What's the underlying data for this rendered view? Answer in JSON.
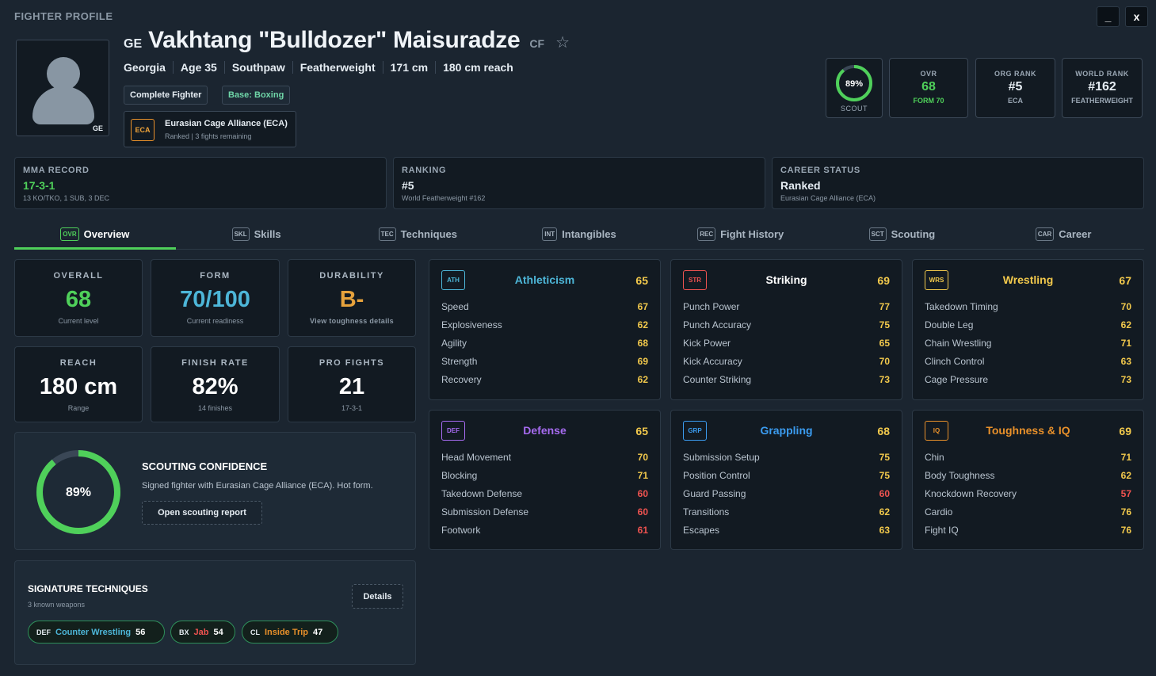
{
  "window": {
    "title": "FIGHTER PROFILE",
    "minimize": "_",
    "close": "x"
  },
  "fighter": {
    "country_code": "GE",
    "name": "Vakhtang \"Bulldozer\" Maisuradze",
    "ring_code": "CF",
    "info": [
      "Georgia",
      "Age 35",
      "Southpaw",
      "Featherweight",
      "171 cm",
      "180 cm reach"
    ],
    "tags": [
      {
        "label": "Complete Fighter",
        "color": "#e6edf3"
      },
      {
        "label": "Base: Boxing",
        "color": "#6fd6a8"
      }
    ],
    "org": {
      "logo": "ECA",
      "name": "Eurasian Cage Alliance (ECA)",
      "status": "Ranked | 3 fights remaining"
    }
  },
  "header_stats": {
    "scout": {
      "pct": "89%",
      "value": 0.89,
      "label": "SCOUT"
    },
    "ovr": {
      "label": "OVR",
      "value": "68",
      "sub": "FORM 70",
      "color": "#4fd05a"
    },
    "org_rank": {
      "label": "ORG RANK",
      "value": "#5",
      "sub": "ECA",
      "color": "#ffffff"
    },
    "world_rank": {
      "label": "WORLD RANK",
      "value": "#162",
      "sub": "FEATHERWEIGHT",
      "color": "#ffffff"
    }
  },
  "summary": {
    "record": {
      "label": "MMA RECORD",
      "value": "17-3-1",
      "sub": "13 KO/TKO, 1 SUB, 3 DEC",
      "color": "#4fd05a"
    },
    "ranking": {
      "label": "RANKING",
      "value": "#5",
      "sub": "World Featherweight #162",
      "color": "#ffffff"
    },
    "career": {
      "label": "CAREER STATUS",
      "value": "Ranked",
      "sub": "Eurasian Cage Alliance (ECA)",
      "color": "#ffffff"
    }
  },
  "tabs": [
    {
      "icon": "OVR",
      "label": "Overview",
      "active": true
    },
    {
      "icon": "SKL",
      "label": "Skills"
    },
    {
      "icon": "TEC",
      "label": "Techniques"
    },
    {
      "icon": "INT",
      "label": "Intangibles"
    },
    {
      "icon": "REC",
      "label": "Fight History"
    },
    {
      "icon": "SCT",
      "label": "Scouting"
    },
    {
      "icon": "CAR",
      "label": "Career"
    }
  ],
  "overview": [
    {
      "label": "OVERALL",
      "value": "68",
      "sub": "Current level",
      "color": "#4fd05a"
    },
    {
      "label": "FORM",
      "value": "70/100",
      "sub": "Current readiness",
      "color": "#4db6d8"
    },
    {
      "label": "DURABILITY",
      "value": "B-",
      "sub": "View toughness details",
      "color": "#e6a23c"
    },
    {
      "label": "REACH",
      "value": "180 cm",
      "sub": "Range",
      "color": "#ffffff"
    },
    {
      "label": "FINISH RATE",
      "value": "82%",
      "sub": "14 finishes",
      "color": "#ffffff"
    },
    {
      "label": "PRO FIGHTS",
      "value": "21",
      "sub": "17-3-1",
      "color": "#ffffff"
    }
  ],
  "scouting": {
    "pct": "89%",
    "value": 0.89,
    "title": "SCOUTING CONFIDENCE",
    "desc": "Signed fighter with Eurasian Cage Alliance (ECA). Hot form.",
    "button": "Open scouting report"
  },
  "signature": {
    "title": "SIGNATURE TECHNIQUES",
    "sub": "3 known weapons",
    "button": "Details",
    "items": [
      {
        "icon": "DEF",
        "name": "Counter Wrestling",
        "value": "56",
        "color": "#4db6d8"
      },
      {
        "icon": "BX",
        "name": "Jab",
        "value": "54",
        "color": "#ef5350"
      },
      {
        "icon": "CL",
        "name": "Inside Trip",
        "value": "47",
        "color": "#e8902a"
      }
    ]
  },
  "categories": [
    {
      "icon": "ATH",
      "name": "Athleticism",
      "value": "65",
      "color": "#4db6d8",
      "rows": [
        [
          "Speed",
          "67"
        ],
        [
          "Explosiveness",
          "62"
        ],
        [
          "Agility",
          "68"
        ],
        [
          "Strength",
          "69"
        ],
        [
          "Recovery",
          "62"
        ]
      ]
    },
    {
      "icon": "STR",
      "name": "Striking",
      "value": "69",
      "color": "#ef5350",
      "name_color": "#ffffff",
      "rows": [
        [
          "Punch Power",
          "77"
        ],
        [
          "Punch Accuracy",
          "75"
        ],
        [
          "Kick Power",
          "65"
        ],
        [
          "Kick Accuracy",
          "70"
        ],
        [
          "Counter Striking",
          "73"
        ]
      ]
    },
    {
      "icon": "WRS",
      "name": "Wrestling",
      "value": "67",
      "color": "#f2c94c",
      "rows": [
        [
          "Takedown Timing",
          "70"
        ],
        [
          "Double Leg",
          "62"
        ],
        [
          "Chain Wrestling",
          "71"
        ],
        [
          "Clinch Control",
          "63"
        ],
        [
          "Cage Pressure",
          "73"
        ]
      ]
    },
    {
      "icon": "DEF",
      "name": "Defense",
      "value": "65",
      "color": "#a66bf0",
      "rows": [
        [
          "Head Movement",
          "70"
        ],
        [
          "Blocking",
          "71"
        ],
        [
          "Takedown Defense",
          "60"
        ],
        [
          "Submission Defense",
          "60"
        ],
        [
          "Footwork",
          "61"
        ]
      ]
    },
    {
      "icon": "GRP",
      "name": "Grappling",
      "value": "68",
      "color": "#3b9cf0",
      "rows": [
        [
          "Submission Setup",
          "75"
        ],
        [
          "Position Control",
          "75"
        ],
        [
          "Guard Passing",
          "60"
        ],
        [
          "Transitions",
          "62"
        ],
        [
          "Escapes",
          "63"
        ]
      ]
    },
    {
      "icon": "IQ",
      "name": "Toughness & IQ",
      "value": "69",
      "color": "#e8902a",
      "rows": [
        [
          "Chin",
          "71"
        ],
        [
          "Body Toughness",
          "62"
        ],
        [
          "Knockdown Recovery",
          "57"
        ],
        [
          "Cardio",
          "76"
        ],
        [
          "Fight IQ",
          "76"
        ]
      ]
    }
  ],
  "value_colors": {
    "high": "#f2c94c",
    "low": "#ef5350"
  }
}
